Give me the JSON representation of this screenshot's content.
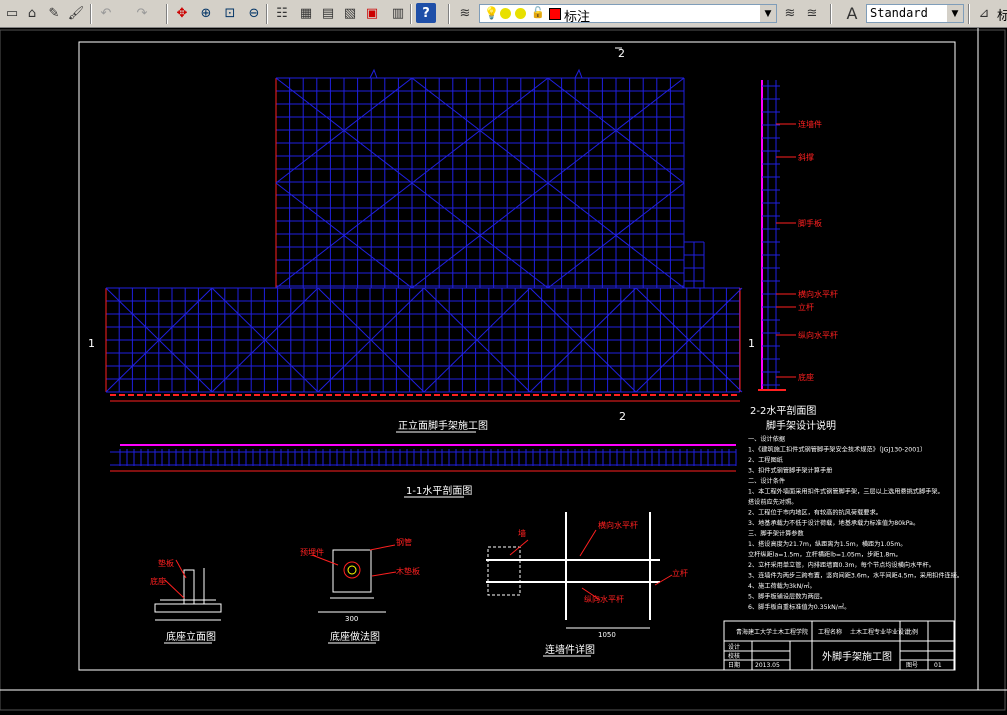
{
  "toolbar": {
    "icons": [
      "new-icon",
      "open-icon",
      "save-icon",
      "matchprop-icon",
      "undo-icon",
      "redo-icon",
      "pan-icon",
      "zoom-realtime-icon",
      "zoom-window-icon",
      "zoom-previous-icon",
      "properties-icon",
      "design-center-icon",
      "tool-palettes-icon",
      "sheet-set-icon",
      "markup-icon",
      "calculator-icon",
      "help-icon",
      "layer-manager-icon",
      "layer-state-icon",
      "text-style-icon"
    ],
    "layer_name": "标注",
    "layer_color": "#ff0000",
    "text_style": "Standard",
    "clipped_label": "标"
  },
  "drawing": {
    "colors": {
      "grid": "#2020e0",
      "base": "#ff2020",
      "frame": "#ffffff",
      "edge": "#ff00ff"
    },
    "titles": {
      "front_elevation": "正立面脚手架施工图",
      "plan_1_1": "1-1水平剖面图",
      "section_2_2": "2-2水平剖面图",
      "base_detail": "底座立面图",
      "tie_detail": "连墙件详图",
      "wall_detail": "底座做法图"
    },
    "section_marks": {
      "mark_1_left": "1",
      "mark_1_right": "1",
      "mark_2_top": "2",
      "mark_2_bottom": "2"
    },
    "section_labels": [
      "连墙件",
      "斜撑",
      "脚手板",
      "横向水平杆",
      "立杆",
      "纵向水平杆",
      "底座"
    ],
    "detail_labels": {
      "base": [
        "垫板",
        "底座"
      ],
      "wall": [
        "预埋件",
        "木垫板",
        "钢管"
      ],
      "tie": [
        "墙",
        "横向水平杆",
        "纵向水平杆",
        "立杆"
      ]
    },
    "dims": {
      "wall_dim": "300",
      "tie_dim": "1050"
    },
    "notes": {
      "heading": "脚手架设计说明",
      "lines": [
        "一、设计依据",
        "1、《建筑施工扣件式钢管脚手架安全技术规范》（JGJ130-2001）",
        "2、工程图纸",
        "3、扣件式钢管脚手架计算手册",
        "二、设计条件",
        "1、本工程外墙面采用扣件式钢管脚手架，三层以上选用悬挑式脚手架。",
        "   搭设前应先对照。",
        "2、工程位于市内地区，有较高的抗风荷载要求。",
        "3、地基承载力不低于设计荷载，地基承载力标准值为80kPa。",
        "三、脚手架计算参数",
        "1、搭设高度为21.7m，纵距离为1.5m，横距为1.05m。",
        "   立杆纵距la=1.5m，立杆横距lb=1.05m，步距1.8m。",
        "2、立杆采用单立管，内排距墙面0.3m，每个节点均设横向水平杆。",
        "3、连墙件为两步三跨布置，竖向间距3.6m，水平间距4.5m，采用扣件连接。",
        "4、施工荷载为3kN/㎡。",
        "5、脚手板铺设层数为两层。",
        "6、脚手板自重标准值为0.35kN/㎡。"
      ]
    },
    "title_block": {
      "company": "青海建工大学土木工程学院",
      "drawing_title": "外脚手架施工图",
      "design_label": "设计",
      "checked_label": "校核",
      "date_label": "日期",
      "date": "2013.05",
      "scale_label": "比例",
      "sheet_label": "图号",
      "sheet_no": "01",
      "project_label": "工程名称",
      "project_name": "土木工程专业毕业设计"
    }
  }
}
